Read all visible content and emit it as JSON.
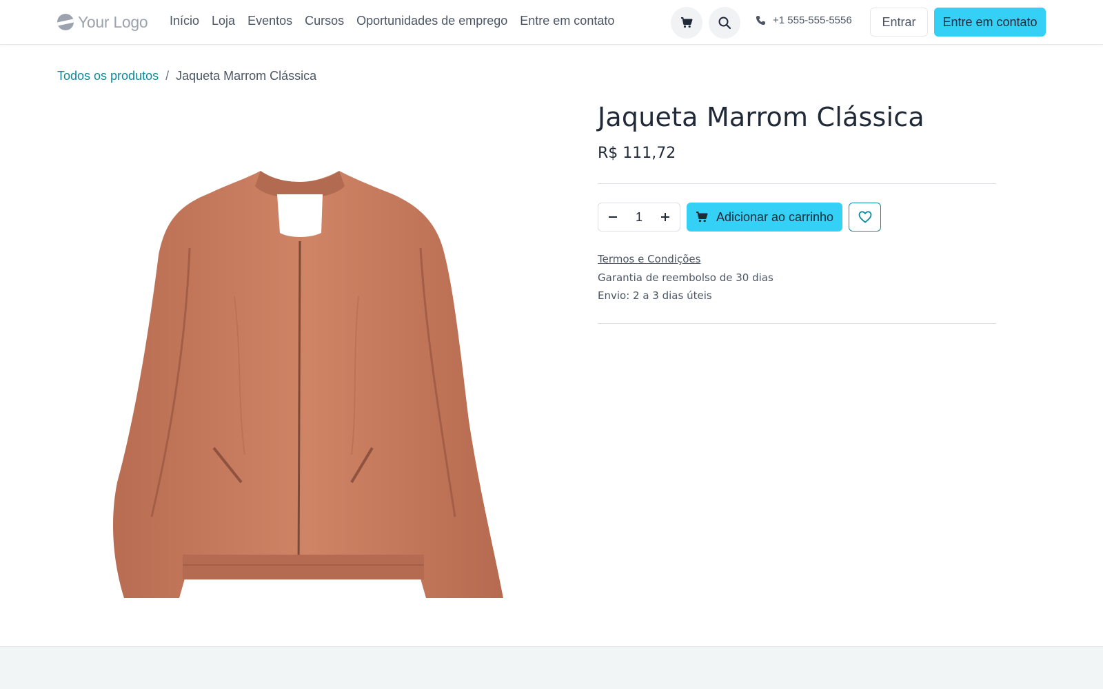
{
  "header": {
    "logo_text": "Your Logo",
    "nav": [
      "Início",
      "Loja",
      "Eventos",
      "Cursos",
      "Oportunidades de emprego",
      "Entre em contato"
    ],
    "phone": "+1 555-555-5556",
    "login_label": "Entrar",
    "contact_label": "Entre em contato",
    "icons": [
      "cart-icon",
      "search-icon",
      "phone-icon"
    ]
  },
  "breadcrumb": {
    "link": "Todos os produtos",
    "separator": "/",
    "current": "Jaqueta Marrom Clássica"
  },
  "product": {
    "title": "Jaqueta Marrom Clássica",
    "price": "R$ 111,72",
    "quantity": "1",
    "add_to_cart_label": "Adicionar ao carrinho",
    "terms_label": "Termos e Condições",
    "guarantee": "Garantia de reembolso de 30 dias",
    "shipping": "Envio: 2 a 3 dias úteis"
  },
  "colors": {
    "accent": "#35d0f5",
    "link": "#0e8a9d",
    "jacket": "#c97b5e"
  }
}
